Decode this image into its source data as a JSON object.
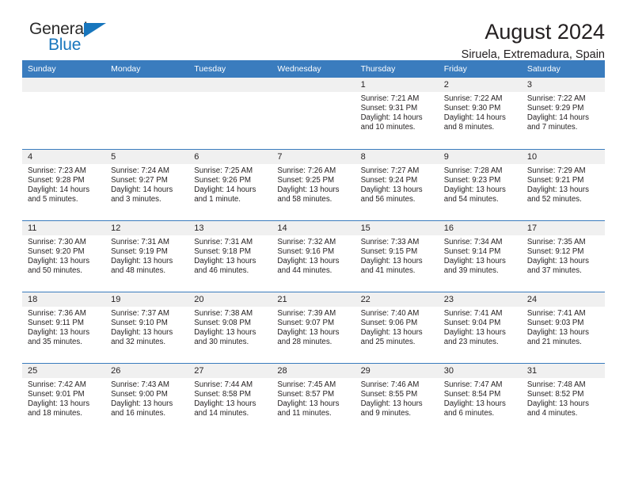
{
  "brand": {
    "name_top": "General",
    "name_bottom": "Blue",
    "accent_color": "#1876bd"
  },
  "header": {
    "title": "August 2024",
    "subtitle": "Siruela, Extremadura, Spain"
  },
  "calendar": {
    "header_bg": "#3a7cbe",
    "daynum_bg": "#f0f0f0",
    "weekday_headers": [
      "Sunday",
      "Monday",
      "Tuesday",
      "Wednesday",
      "Thursday",
      "Friday",
      "Saturday"
    ],
    "weeks": [
      [
        {
          "empty": true
        },
        {
          "empty": true
        },
        {
          "empty": true
        },
        {
          "empty": true
        },
        {
          "day": "1",
          "sunrise": "Sunrise: 7:21 AM",
          "sunset": "Sunset: 9:31 PM",
          "daylight1": "Daylight: 14 hours",
          "daylight2": "and 10 minutes."
        },
        {
          "day": "2",
          "sunrise": "Sunrise: 7:22 AM",
          "sunset": "Sunset: 9:30 PM",
          "daylight1": "Daylight: 14 hours",
          "daylight2": "and 8 minutes."
        },
        {
          "day": "3",
          "sunrise": "Sunrise: 7:22 AM",
          "sunset": "Sunset: 9:29 PM",
          "daylight1": "Daylight: 14 hours",
          "daylight2": "and 7 minutes."
        }
      ],
      [
        {
          "day": "4",
          "sunrise": "Sunrise: 7:23 AM",
          "sunset": "Sunset: 9:28 PM",
          "daylight1": "Daylight: 14 hours",
          "daylight2": "and 5 minutes."
        },
        {
          "day": "5",
          "sunrise": "Sunrise: 7:24 AM",
          "sunset": "Sunset: 9:27 PM",
          "daylight1": "Daylight: 14 hours",
          "daylight2": "and 3 minutes."
        },
        {
          "day": "6",
          "sunrise": "Sunrise: 7:25 AM",
          "sunset": "Sunset: 9:26 PM",
          "daylight1": "Daylight: 14 hours",
          "daylight2": "and 1 minute."
        },
        {
          "day": "7",
          "sunrise": "Sunrise: 7:26 AM",
          "sunset": "Sunset: 9:25 PM",
          "daylight1": "Daylight: 13 hours",
          "daylight2": "and 58 minutes."
        },
        {
          "day": "8",
          "sunrise": "Sunrise: 7:27 AM",
          "sunset": "Sunset: 9:24 PM",
          "daylight1": "Daylight: 13 hours",
          "daylight2": "and 56 minutes."
        },
        {
          "day": "9",
          "sunrise": "Sunrise: 7:28 AM",
          "sunset": "Sunset: 9:23 PM",
          "daylight1": "Daylight: 13 hours",
          "daylight2": "and 54 minutes."
        },
        {
          "day": "10",
          "sunrise": "Sunrise: 7:29 AM",
          "sunset": "Sunset: 9:21 PM",
          "daylight1": "Daylight: 13 hours",
          "daylight2": "and 52 minutes."
        }
      ],
      [
        {
          "day": "11",
          "sunrise": "Sunrise: 7:30 AM",
          "sunset": "Sunset: 9:20 PM",
          "daylight1": "Daylight: 13 hours",
          "daylight2": "and 50 minutes."
        },
        {
          "day": "12",
          "sunrise": "Sunrise: 7:31 AM",
          "sunset": "Sunset: 9:19 PM",
          "daylight1": "Daylight: 13 hours",
          "daylight2": "and 48 minutes."
        },
        {
          "day": "13",
          "sunrise": "Sunrise: 7:31 AM",
          "sunset": "Sunset: 9:18 PM",
          "daylight1": "Daylight: 13 hours",
          "daylight2": "and 46 minutes."
        },
        {
          "day": "14",
          "sunrise": "Sunrise: 7:32 AM",
          "sunset": "Sunset: 9:16 PM",
          "daylight1": "Daylight: 13 hours",
          "daylight2": "and 44 minutes."
        },
        {
          "day": "15",
          "sunrise": "Sunrise: 7:33 AM",
          "sunset": "Sunset: 9:15 PM",
          "daylight1": "Daylight: 13 hours",
          "daylight2": "and 41 minutes."
        },
        {
          "day": "16",
          "sunrise": "Sunrise: 7:34 AM",
          "sunset": "Sunset: 9:14 PM",
          "daylight1": "Daylight: 13 hours",
          "daylight2": "and 39 minutes."
        },
        {
          "day": "17",
          "sunrise": "Sunrise: 7:35 AM",
          "sunset": "Sunset: 9:12 PM",
          "daylight1": "Daylight: 13 hours",
          "daylight2": "and 37 minutes."
        }
      ],
      [
        {
          "day": "18",
          "sunrise": "Sunrise: 7:36 AM",
          "sunset": "Sunset: 9:11 PM",
          "daylight1": "Daylight: 13 hours",
          "daylight2": "and 35 minutes."
        },
        {
          "day": "19",
          "sunrise": "Sunrise: 7:37 AM",
          "sunset": "Sunset: 9:10 PM",
          "daylight1": "Daylight: 13 hours",
          "daylight2": "and 32 minutes."
        },
        {
          "day": "20",
          "sunrise": "Sunrise: 7:38 AM",
          "sunset": "Sunset: 9:08 PM",
          "daylight1": "Daylight: 13 hours",
          "daylight2": "and 30 minutes."
        },
        {
          "day": "21",
          "sunrise": "Sunrise: 7:39 AM",
          "sunset": "Sunset: 9:07 PM",
          "daylight1": "Daylight: 13 hours",
          "daylight2": "and 28 minutes."
        },
        {
          "day": "22",
          "sunrise": "Sunrise: 7:40 AM",
          "sunset": "Sunset: 9:06 PM",
          "daylight1": "Daylight: 13 hours",
          "daylight2": "and 25 minutes."
        },
        {
          "day": "23",
          "sunrise": "Sunrise: 7:41 AM",
          "sunset": "Sunset: 9:04 PM",
          "daylight1": "Daylight: 13 hours",
          "daylight2": "and 23 minutes."
        },
        {
          "day": "24",
          "sunrise": "Sunrise: 7:41 AM",
          "sunset": "Sunset: 9:03 PM",
          "daylight1": "Daylight: 13 hours",
          "daylight2": "and 21 minutes."
        }
      ],
      [
        {
          "day": "25",
          "sunrise": "Sunrise: 7:42 AM",
          "sunset": "Sunset: 9:01 PM",
          "daylight1": "Daylight: 13 hours",
          "daylight2": "and 18 minutes."
        },
        {
          "day": "26",
          "sunrise": "Sunrise: 7:43 AM",
          "sunset": "Sunset: 9:00 PM",
          "daylight1": "Daylight: 13 hours",
          "daylight2": "and 16 minutes."
        },
        {
          "day": "27",
          "sunrise": "Sunrise: 7:44 AM",
          "sunset": "Sunset: 8:58 PM",
          "daylight1": "Daylight: 13 hours",
          "daylight2": "and 14 minutes."
        },
        {
          "day": "28",
          "sunrise": "Sunrise: 7:45 AM",
          "sunset": "Sunset: 8:57 PM",
          "daylight1": "Daylight: 13 hours",
          "daylight2": "and 11 minutes."
        },
        {
          "day": "29",
          "sunrise": "Sunrise: 7:46 AM",
          "sunset": "Sunset: 8:55 PM",
          "daylight1": "Daylight: 13 hours",
          "daylight2": "and 9 minutes."
        },
        {
          "day": "30",
          "sunrise": "Sunrise: 7:47 AM",
          "sunset": "Sunset: 8:54 PM",
          "daylight1": "Daylight: 13 hours",
          "daylight2": "and 6 minutes."
        },
        {
          "day": "31",
          "sunrise": "Sunrise: 7:48 AM",
          "sunset": "Sunset: 8:52 PM",
          "daylight1": "Daylight: 13 hours",
          "daylight2": "and 4 minutes."
        }
      ]
    ]
  }
}
